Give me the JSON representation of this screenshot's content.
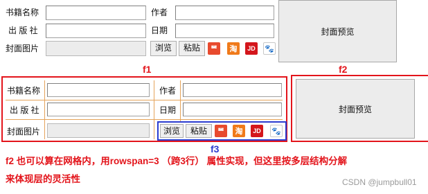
{
  "top_form": {
    "book_name_label": "书籍名称",
    "publisher_label": "出 版 社",
    "cover_label": "封面图片",
    "author_label": "作者",
    "date_label": "日期",
    "browse_button": "浏览",
    "paste_button": "粘贴",
    "preview_text": "封面预览"
  },
  "bottom_form": {
    "book_name_label": "书籍名称",
    "publisher_label": "出 版 社",
    "cover_label": "封面图片",
    "author_label": "作者",
    "date_label": "日期",
    "browse_button": "浏览",
    "paste_button": "粘贴",
    "preview_text": "封面预览"
  },
  "icons": {
    "i1": "ꥲ",
    "i2": "淘",
    "jd": "JD",
    "paw": "🐾"
  },
  "annotations": {
    "f1": "f1",
    "f2": "f2",
    "f3": "f3",
    "note_line1": "f2 也可以算在网格内，用rowspan=3 （跨3行） 属性实现，但这里按多层结构分解",
    "note_line2": "来体现层的灵活性"
  },
  "watermark": "CSDN @jumpbull01",
  "colors": {
    "annotation_red": "#e3141b",
    "annotation_blue": "#2a3bcf",
    "grid_orange": "#e5a35a"
  }
}
